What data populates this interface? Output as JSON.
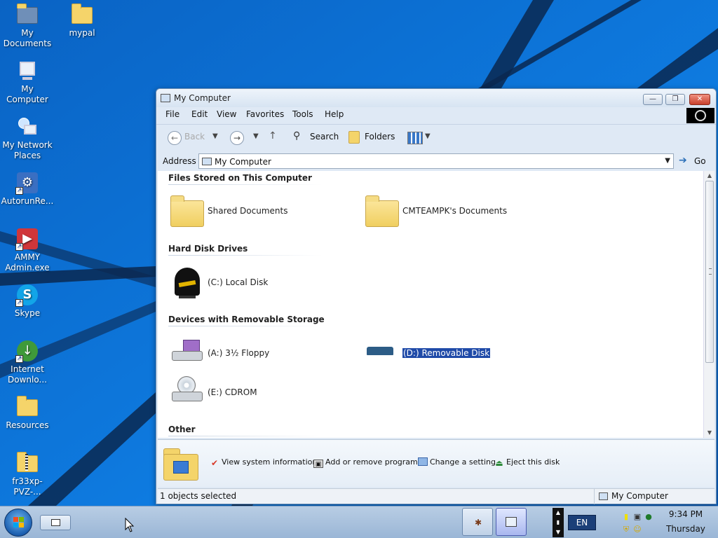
{
  "desktop": {
    "icons": [
      {
        "label": "My Documents",
        "icon": "my-documents-icon"
      },
      {
        "label": "mypal",
        "icon": "folder-icon"
      },
      {
        "label": "My Computer",
        "icon": "my-computer-icon"
      },
      {
        "label": "My Network Places",
        "icon": "network-places-icon"
      },
      {
        "label": "AutorunRe...",
        "icon": "autorun-icon"
      },
      {
        "label": "AMMY Admin.exe",
        "icon": "ammy-admin-icon"
      },
      {
        "label": "Skype",
        "icon": "skype-icon"
      },
      {
        "label": "Internet Downlo...",
        "icon": "internet-download-manager-icon"
      },
      {
        "label": "Resources",
        "icon": "folder-icon"
      },
      {
        "label": "fr33xp-PVZ-...",
        "icon": "zip-folder-icon"
      }
    ]
  },
  "window": {
    "title": "My Computer",
    "menu": [
      "File",
      "Edit",
      "View",
      "Favorites",
      "Tools",
      "Help"
    ],
    "toolbar": {
      "back_label": "Back",
      "search_label": "Search",
      "folders_label": "Folders"
    },
    "address": {
      "label": "Address",
      "value": "My Computer",
      "go_label": "Go"
    },
    "groups": [
      {
        "header": "Files Stored on This Computer",
        "items": [
          {
            "label": "Shared Documents",
            "icon": "folder-icon"
          },
          {
            "label": "CMTEAMPK's Documents",
            "icon": "folder-icon"
          }
        ]
      },
      {
        "header": "Hard Disk Drives",
        "items": [
          {
            "label": "(C:) Local Disk",
            "icon": "local-disk-icon"
          }
        ]
      },
      {
        "header": "Devices with Removable Storage",
        "items": [
          {
            "label": "(A:) 3½ Floppy",
            "icon": "floppy-drive-icon"
          },
          {
            "label": "(D:) Removable Disk",
            "icon": "removable-disk-icon",
            "selected": true
          },
          {
            "label": "(E:) CDROM",
            "icon": "cdrom-drive-icon"
          }
        ]
      },
      {
        "header": "Other",
        "items": []
      }
    ],
    "tasks": [
      {
        "label": "View system information",
        "icon": "checkmark-icon"
      },
      {
        "label": "Add or remove programs",
        "icon": "programs-icon"
      },
      {
        "label": "Change a setting",
        "icon": "control-panel-icon"
      },
      {
        "label": "Eject this disk",
        "icon": "eject-icon"
      }
    ],
    "status": {
      "left": "1 objects selected",
      "right": "My Computer"
    }
  },
  "taskbar": {
    "language": "EN",
    "time": "9:34 PM",
    "day": "Thursday"
  },
  "colors": {
    "desktop_blue": "#0b6fd0",
    "selection": "#1f4aa8",
    "taskbar": "#a9c2de"
  }
}
